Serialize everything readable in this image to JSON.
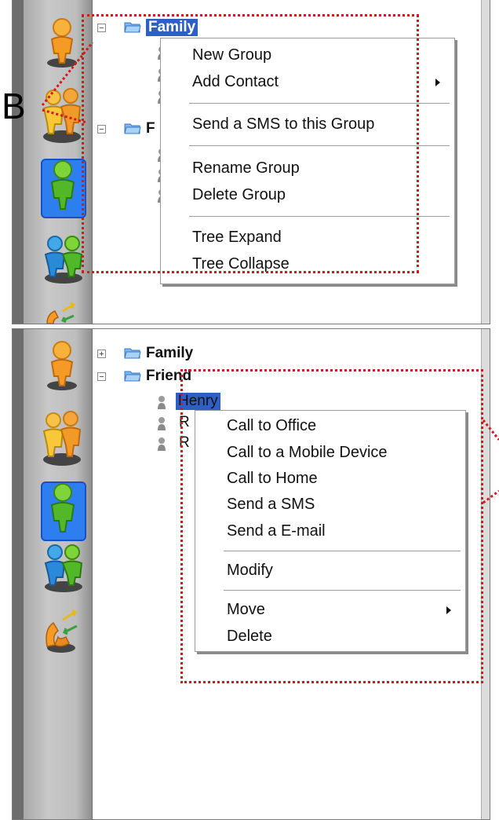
{
  "annotation": {
    "label": "B",
    "highlight_color": "#d8161b"
  },
  "sidebar": {
    "icons": [
      "person-orange-icon",
      "group-people-icon",
      "person-green-selected-icon",
      "group-blue-green-icon",
      "phone-transfer-icon"
    ]
  },
  "top_panel": {
    "tree": {
      "group1": {
        "label": "Family",
        "expander": "−",
        "icon": "folder-icon"
      },
      "group2": {
        "label": "F",
        "expander": "−",
        "icon": "folder-icon"
      }
    },
    "context_menu": {
      "items": [
        {
          "label": "New Group"
        },
        {
          "label": "Add Contact",
          "submenu": true
        },
        {
          "label": "Send a SMS to this Group"
        },
        {
          "label": "Rename Group"
        },
        {
          "label": "Delete Group"
        },
        {
          "label": "Tree Expand"
        },
        {
          "label": "Tree Collapse"
        }
      ]
    }
  },
  "bottom_panel": {
    "tree": {
      "group1": {
        "label": "Family",
        "expander": "+",
        "icon": "folder-icon"
      },
      "group2": {
        "label": "Friend",
        "expander": "−",
        "icon": "folder-icon"
      },
      "contacts": [
        {
          "label": "Henry",
          "selected": true
        },
        {
          "label": "R"
        },
        {
          "label": "R"
        }
      ]
    },
    "context_menu": {
      "items": [
        {
          "label": "Call to Office"
        },
        {
          "label": "Call to a Mobile Device"
        },
        {
          "label": "Call to Home"
        },
        {
          "label": "Send a SMS"
        },
        {
          "label": "Send a E-mail"
        },
        {
          "label": "Modify"
        },
        {
          "label": "Move",
          "submenu": true
        },
        {
          "label": "Delete"
        }
      ]
    }
  }
}
